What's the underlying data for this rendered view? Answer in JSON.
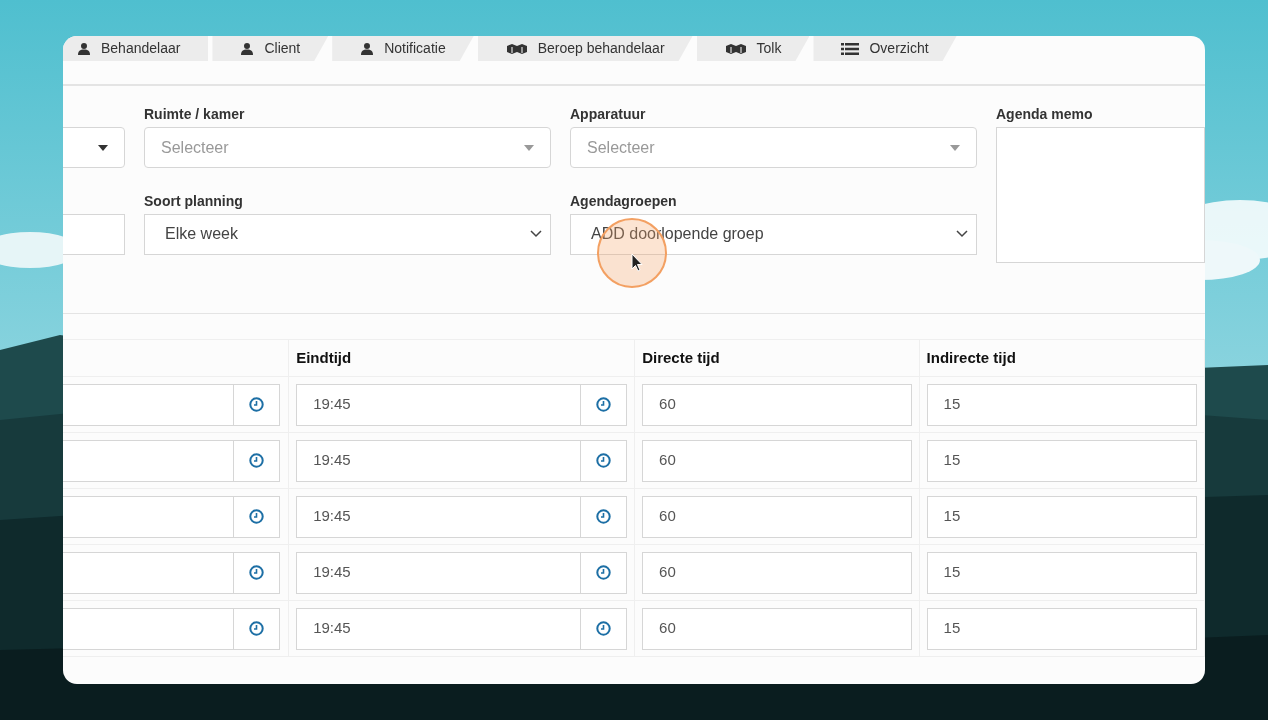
{
  "tabs": [
    {
      "label": "Behandelaar",
      "kind": "user"
    },
    {
      "label": "Client",
      "kind": "user"
    },
    {
      "label": "Notificatie",
      "kind": "user"
    },
    {
      "label": "Beroep behandelaar",
      "kind": "cubes"
    },
    {
      "label": "Tolk",
      "kind": "cubes"
    },
    {
      "label": "Overzicht",
      "kind": "list"
    }
  ],
  "form": {
    "rows": [
      [
        {
          "kind": "select-caret"
        },
        {
          "kind": "select-caret",
          "label": "Ruimte / kamer",
          "placeholder": "Selecteer"
        },
        {
          "kind": "select-caret",
          "label": "Apparatuur",
          "placeholder": "Selecteer"
        }
      ],
      [
        {
          "kind": "input"
        },
        {
          "kind": "select-chevron",
          "label": "Soort planning",
          "value": "Elke week"
        },
        {
          "kind": "select-chevron",
          "label": "Agendagroepen",
          "value": "ADD doorlopende groep"
        }
      ]
    ],
    "memo": {
      "label": "Agenda memo"
    }
  },
  "table": {
    "columns": [
      "Eindtijd",
      "Directe tijd",
      "Indirecte tijd"
    ],
    "rows": [
      {
        "cells": [
          "19:45",
          "60",
          "15"
        ]
      },
      {
        "cells": [
          "19:45",
          "60",
          "15"
        ]
      },
      {
        "cells": [
          "19:45",
          "60",
          "15"
        ]
      },
      {
        "cells": [
          "19:45",
          "60",
          "15"
        ]
      },
      {
        "cells": [
          "19:45",
          "60",
          "15"
        ]
      }
    ]
  }
}
